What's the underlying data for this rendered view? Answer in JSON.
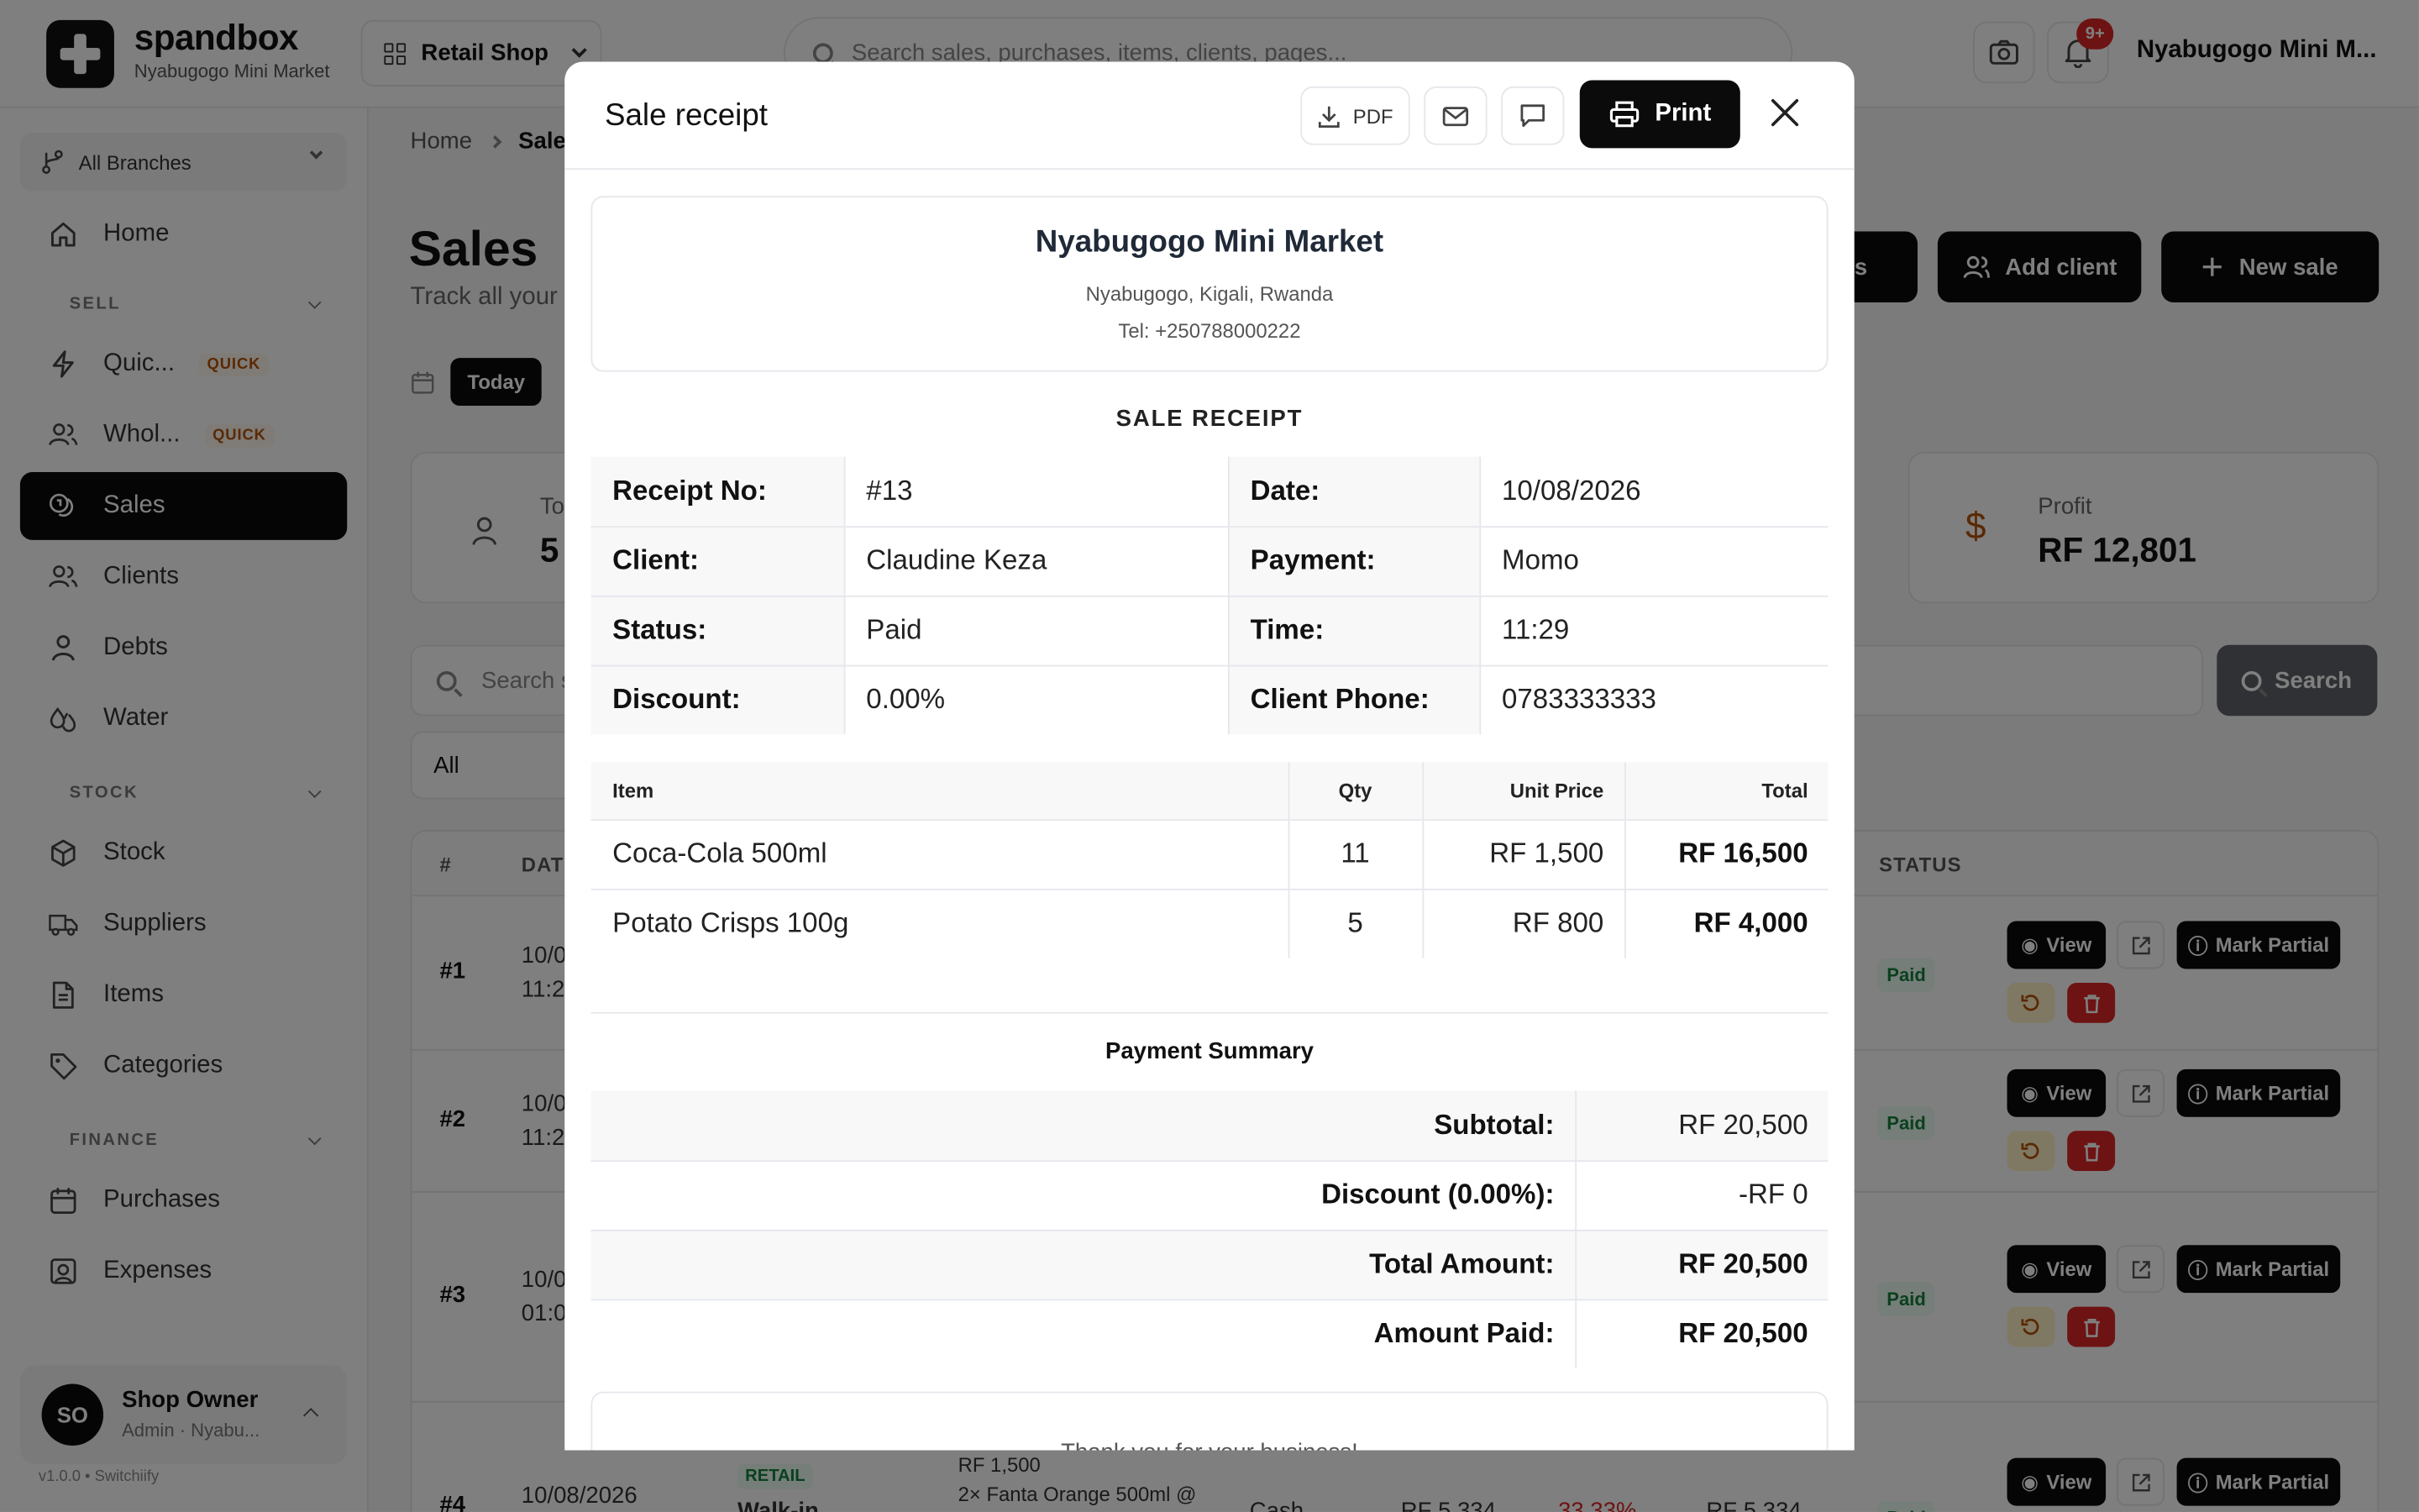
{
  "app": {
    "brand": "spandbox",
    "brand_sub": "Nyabugogo Mini Market",
    "shop_select": "Retail Shop",
    "search_placeholder": "Search sales, purchases, items, clients, pages...",
    "notif_count": "9+",
    "user_name": "Nyabugogo Mini M..."
  },
  "sidebar": {
    "branch": "All Branches",
    "sections": {
      "sell": "SELL",
      "stock": "STOCK",
      "finance": "FINANCE"
    },
    "items": {
      "home": "Home",
      "quick": "Quic...",
      "whole": "Whol...",
      "sales": "Sales",
      "clients": "Clients",
      "debts": "Debts",
      "water": "Water",
      "stock": "Stock",
      "suppliers": "Suppliers",
      "items": "Items",
      "categories": "Categories",
      "purchases": "Purchases",
      "expenses": "Expenses"
    },
    "quick_badge": "QUICK",
    "owner_name": "Shop Owner",
    "owner_role": "Admin · Nyabu...",
    "owner_initials": "SO",
    "version": "v1.0.0 • Switchiify"
  },
  "main": {
    "breadcrumb_home": "Home",
    "breadcrumb_current": "Sales",
    "title": "Sales",
    "subtitle": "Track all your",
    "btn_clients": "ents",
    "btn_add_client": "Add client",
    "btn_new_sale": "New sale",
    "today": "Today",
    "stat_total_label": "To",
    "stat_total_value": "5",
    "stat_profit_label": "Profit",
    "stat_profit_value": "RF 12,801",
    "search_placeholder": "Search s",
    "search_btn": "Search",
    "filter_all": "All",
    "col_num": "#",
    "col_date": "DATE",
    "col_status": "STATUS",
    "rows": [
      {
        "num": "#1",
        "date1": "10/0",
        "date2": "11:2",
        "status": "Paid"
      },
      {
        "num": "#2",
        "date1": "10/0",
        "date2": "11:2",
        "status": "Paid"
      },
      {
        "num": "#3",
        "date1": "10/0",
        "date2": "01:0",
        "status": "Paid"
      },
      {
        "num": "#4",
        "date1": "10/08/2026",
        "status": "Paid",
        "type": "RETAIL",
        "client": "Walk-in",
        "item1": "RF 1,500",
        "item2": "2× Fanta Orange 500ml @",
        "payment": "Cash",
        "amount": "RF 5,334",
        "pct": "33.33%",
        "total": "RF 5,334"
      }
    ],
    "act_view": "View",
    "act_partial": "Mark Partial"
  },
  "modal": {
    "title": "Sale receipt",
    "pdf": "PDF",
    "print": "Print",
    "store_name": "Nyabugogo Mini Market",
    "store_address": "Nyabugogo, Kigali, Rwanda",
    "store_tel": "Tel: +250788000222",
    "heading": "SALE RECEIPT",
    "info": {
      "receipt_no_k": "Receipt No:",
      "receipt_no_v": "#13",
      "date_k": "Date:",
      "date_v": "10/08/2026",
      "client_k": "Client:",
      "client_v": "Claudine Keza",
      "payment_k": "Payment:",
      "payment_v": "Momo",
      "status_k": "Status:",
      "status_v": "Paid",
      "time_k": "Time:",
      "time_v": "11:29",
      "discount_k": "Discount:",
      "discount_v": "0.00%",
      "phone_k": "Client Phone:",
      "phone_v": "0783333333"
    },
    "items_header": {
      "item": "Item",
      "qty": "Qty",
      "unit_price": "Unit Price",
      "total": "Total"
    },
    "items": [
      {
        "name": "Coca-Cola 500ml",
        "qty": "11",
        "unit_price": "RF 1,500",
        "total": "RF 16,500"
      },
      {
        "name": "Potato Crisps 100g",
        "qty": "5",
        "unit_price": "RF 800",
        "total": "RF 4,000"
      }
    ],
    "pay_heading": "Payment Summary",
    "summary": {
      "subtotal_k": "Subtotal:",
      "subtotal_v": "RF 20,500",
      "discount_k": "Discount (0.00%):",
      "discount_v": "-RF 0",
      "total_k": "Total Amount:",
      "total_v": "RF 20,500",
      "paid_k": "Amount Paid:",
      "paid_v": "RF 20,500"
    },
    "thanks": "Thank you for your business!"
  }
}
